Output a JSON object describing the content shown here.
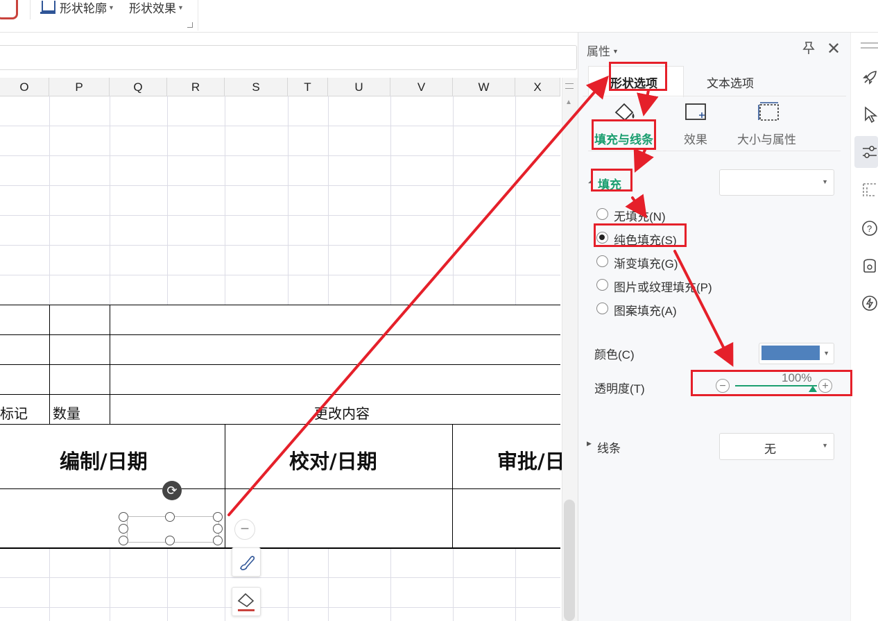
{
  "ribbon": {
    "shape_outline_label": "形状轮廓",
    "shape_effect_label": "形状效果"
  },
  "sheet": {
    "columns": [
      "O",
      "P",
      "Q",
      "R",
      "S",
      "T",
      "U",
      "V",
      "W",
      "X"
    ],
    "table": {
      "mark_label": "标记",
      "qty_label": "数量",
      "change_label": "更改内容",
      "compile_label": "编制/日期",
      "check_label": "校对/日期",
      "approve_label": "审批/日"
    }
  },
  "panel": {
    "title": "属性",
    "tabs": [
      "形状选项",
      "文本选项"
    ],
    "subtabs": [
      "填充与线条",
      "效果",
      "大小与属性"
    ],
    "fill_section": "填充",
    "fill_options": [
      "无填充(N)",
      "纯色填充(S)",
      "渐变填充(G)",
      "图片或纹理填充(P)",
      "图案填充(A)"
    ],
    "selected_fill": "纯色填充(S)",
    "color_label": "颜色(C)",
    "color_value": "#4f81bd",
    "transparency_label": "透明度(T)",
    "transparency_value": "100%",
    "line_section": "线条",
    "line_value": "无"
  },
  "colors": {
    "accent_green": "#1a9e6f",
    "annotation_red": "#e5202a"
  }
}
